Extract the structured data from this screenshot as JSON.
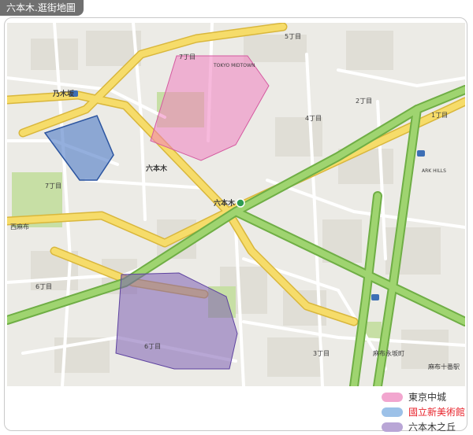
{
  "page_title": "六本木.逛街地圖",
  "map": {
    "labels": {
      "nogizaka": "乃木坂",
      "roppongi_area": "六本木",
      "roppongi_station": "六本木",
      "nishiazabu": "西麻布",
      "azabu_juban_station": "麻布十番駅",
      "azabu_nagasaka": "麻布永坂町",
      "midtown_en": "TOKYO MIDTOWN",
      "ark_hills": "ARK HILLS",
      "chome_7_top": "7丁目",
      "chome_7_left": "7丁目",
      "chome_6_left": "6丁目",
      "chome_6_bottom": "6丁目",
      "chome_5": "5丁目",
      "chome_4": "4丁目",
      "chome_3": "3丁目",
      "chome_2": "2丁目",
      "chome_1": "1丁目"
    }
  },
  "legend": [
    {
      "label": "東京中城",
      "swatch_color": "#f2a6cf",
      "text_color": "#333333"
    },
    {
      "label": "國立新美術館",
      "swatch_color": "#9cc1e8",
      "text_color": "#e8242c"
    },
    {
      "label": "六本木之丘",
      "swatch_color": "#b9a6d6",
      "text_color": "#333333"
    }
  ],
  "colors": {
    "highway": "#9fd470",
    "highway_edge": "#6fae45",
    "major_road": "#f6dc6a",
    "major_road_edge": "#d9b73c",
    "street": "#ffffff",
    "park": "#c7dfa5",
    "midtown_area": "#f07fbf",
    "art_center_area": "#4d79c7",
    "hills_area": "#7d5fb3"
  }
}
